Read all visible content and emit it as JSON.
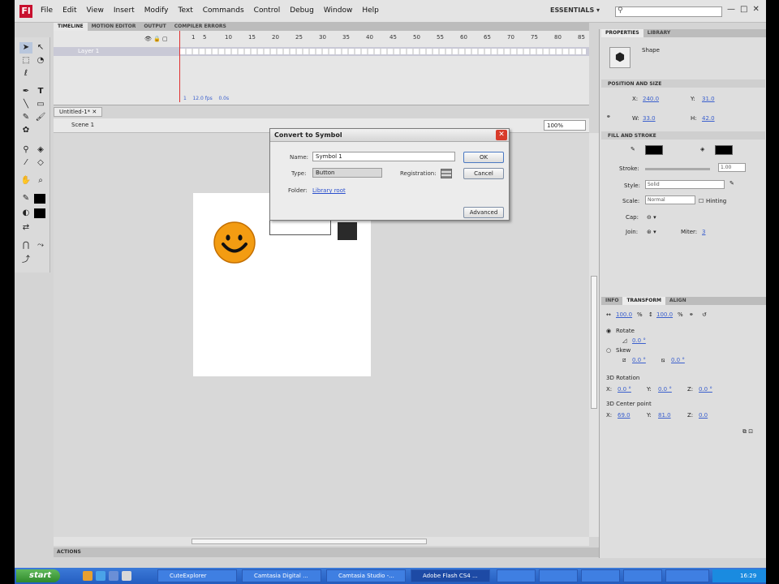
{
  "app": {
    "logo": "Fl"
  },
  "menu": [
    "File",
    "Edit",
    "View",
    "Insert",
    "Modify",
    "Text",
    "Commands",
    "Control",
    "Debug",
    "Window",
    "Help"
  ],
  "workspace": "ESSENTIALS ▾",
  "search_placeholder": "",
  "window_buttons": [
    "—",
    "□",
    "✕"
  ],
  "timeline": {
    "tabs": [
      "TIMELINE",
      "MOTION EDITOR",
      "OUTPUT",
      "COMPILER ERRORS"
    ],
    "ruler": [
      "1",
      "5",
      "10",
      "15",
      "20",
      "25",
      "30",
      "35",
      "40",
      "45",
      "50",
      "55",
      "60",
      "65",
      "70",
      "75",
      "80",
      "85"
    ],
    "layer": "Layer 1",
    "status": [
      "1",
      "12.0 fps",
      "0.0s"
    ]
  },
  "document": {
    "tab": "Untitled-1* ✕",
    "scene": "Scene 1",
    "zoom": "100%"
  },
  "dialog": {
    "title": "Convert to Symbol",
    "name_label": "Name:",
    "name_value": "Symbol 1",
    "type_label": "Type:",
    "type_value": "Button",
    "registration_label": "Registration:",
    "folder_label": "Folder:",
    "folder_value": "Library root",
    "ok": "OK",
    "cancel": "Cancel",
    "advanced": "Advanced",
    "close": "✕"
  },
  "properties": {
    "tabs": [
      "PROPERTIES",
      "LIBRARY"
    ],
    "object_type": "Shape",
    "pos_section": "POSITION AND SIZE",
    "x_label": "X:",
    "x": "240.0",
    "y_label": "Y:",
    "y": "31.0",
    "w_label": "W:",
    "w": "33.0",
    "h_label": "H:",
    "h": "42.0",
    "fill_section": "FILL AND STROKE",
    "stroke_label": "Stroke:",
    "stroke": "1.00",
    "style_label": "Style:",
    "style": "Solid",
    "scale_label": "Scale:",
    "scale": "Normal",
    "hinting_label": "Hinting",
    "cap_label": "Cap:",
    "join_label": "Join:",
    "miter_label": "Miter:",
    "miter": "3"
  },
  "transform": {
    "tabs": [
      "INFO",
      "TRANSFORM",
      "ALIGN"
    ],
    "width": "100.0",
    "height": "100.0",
    "rotate_label": "Rotate",
    "rotate": "0.0 °",
    "skew_label": "Skew",
    "skew_h": "0.0 °",
    "skew_v": "0.0 °",
    "rot3d_label": "3D Rotation",
    "rx": "0.0 °",
    "ry": "0.0 °",
    "rz": "0.0 °",
    "center_label": "3D Center point",
    "cx": "69.0",
    "cy": "81.0",
    "cz": "0.0"
  },
  "actions_label": "ACTIONS",
  "taskbar": {
    "start": "start",
    "tasks": [
      "CuteExplorer",
      "Camtasia Digital ...",
      "Camtasia Studio -...",
      "Adobe Flash CS4 ..."
    ],
    "tray_time": "16:29"
  },
  "colors": {
    "accent": "#c8102e",
    "smiley": "#f39c12",
    "stroke": "#000000",
    "fill": "#000000"
  }
}
